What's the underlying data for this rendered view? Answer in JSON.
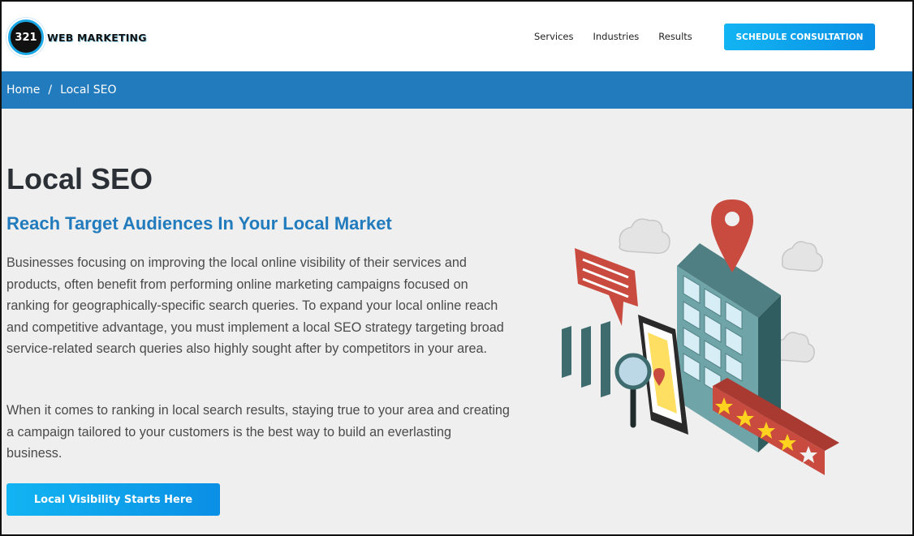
{
  "logo": {
    "number": "321",
    "name": "WEB MARKETING"
  },
  "nav": {
    "items": [
      "Services",
      "Industries",
      "Results"
    ]
  },
  "header": {
    "cta_label": "SCHEDULE CONSULTATION"
  },
  "breadcrumb": {
    "home": "Home",
    "separator": "/",
    "current": "Local SEO"
  },
  "main": {
    "title": "Local SEO",
    "subtitle": "Reach Target Audiences In Your Local Market",
    "paragraph1": "Businesses focusing on improving the local online visibility of their services and products, often benefit from performing online marketing campaigns focused on ranking for geographically-specific search queries. To expand your local online reach and competitive advantage, you must implement a local SEO strategy targeting broad service-related search queries also highly sought after by competitors in your area.",
    "paragraph2": "When it comes to ranking in local search results, staying true to your area and creating a campaign tailored to your customers is the best way to build an everlasting business.",
    "cta_label": "Local Visibility Starts Here"
  },
  "illustration": {
    "icons": [
      "cloud-icon",
      "map-pin-icon",
      "building-icon",
      "chat-bubble-icon",
      "bar-chart-icon",
      "smartphone-map-icon",
      "magnifier-icon",
      "rating-stars-icon"
    ],
    "rating_stars": 5
  },
  "colors": {
    "brand_blue": "#217bbd",
    "cta_gradient_start": "#12b4f2",
    "cta_gradient_end": "#0a8fe5",
    "illustration_red": "#c94a3f",
    "illustration_teal": "#3d6b6e",
    "star_yellow": "#ffd21f"
  }
}
